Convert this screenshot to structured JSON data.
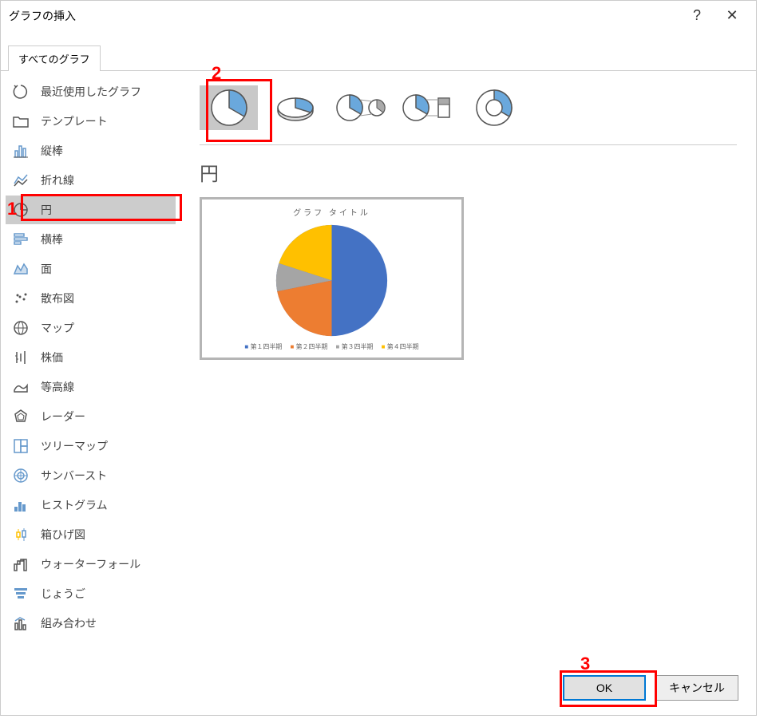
{
  "window_title": "グラフの挿入",
  "tab_label": "すべてのグラフ",
  "sidebar_items": [
    "最近使用したグラフ",
    "テンプレート",
    "縦棒",
    "折れ線",
    "円",
    "横棒",
    "面",
    "散布図",
    "マップ",
    "株価",
    "等高線",
    "レーダー",
    "ツリーマップ",
    "サンバースト",
    "ヒストグラム",
    "箱ひげ図",
    "ウォーターフォール",
    "じょうご",
    "組み合わせ"
  ],
  "selected_sidebar_index": 4,
  "selected_subtype_index": 0,
  "chart_type_heading": "円",
  "chart_preview_title": "グラフ タイトル",
  "legend_labels": [
    "第１四半期",
    "第２四半期",
    "第３四半期",
    "第４四半期"
  ],
  "buttons": {
    "ok": "OK",
    "cancel": "キャンセル"
  },
  "annotations": [
    "1",
    "2",
    "3"
  ],
  "chart_data": {
    "type": "pie",
    "title": "グラフ タイトル",
    "categories": [
      "第１四半期",
      "第２四半期",
      "第３四半期",
      "第４四半期"
    ],
    "values": [
      50,
      25,
      13,
      12
    ],
    "colors": [
      "#4472c4",
      "#ed7d31",
      "#a5a5a5",
      "#ffc000"
    ]
  }
}
